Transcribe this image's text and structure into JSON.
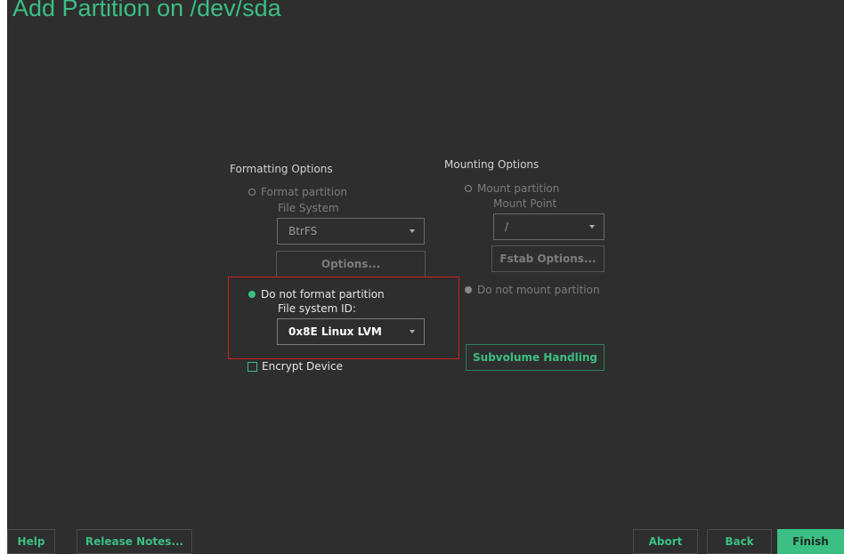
{
  "window": {
    "title": "Add Partition on /dev/sda"
  },
  "formatting": {
    "section_title": "Formatting Options",
    "format_partition": {
      "label": "Format partition"
    },
    "file_system_label": "File System",
    "file_system_value": "BtrFS",
    "options_button": "Options...",
    "do_not_format": {
      "label": "Do not format partition",
      "selected": true
    },
    "file_system_id_label": "File system ID:",
    "file_system_id_value": "0x8E Linux LVM",
    "encrypt_device": {
      "label": "Encrypt Device",
      "checked": false
    }
  },
  "mounting": {
    "section_title": "Mounting Options",
    "mount_partition": {
      "label": "Mount partition"
    },
    "mount_point_label": "Mount Point",
    "mount_point_value": "/",
    "fstab_button": "Fstab Options...",
    "do_not_mount": {
      "label": "Do not mount partition"
    },
    "subvolume_button": "Subvolume Handling"
  },
  "footer": {
    "help": "Help",
    "release_notes": "Release Notes...",
    "abort": "Abort",
    "back": "Back",
    "finish": "Finish"
  },
  "colors": {
    "accent": "#3bbf83",
    "background": "#2e2e2e",
    "highlight": "#cc1f1f"
  }
}
